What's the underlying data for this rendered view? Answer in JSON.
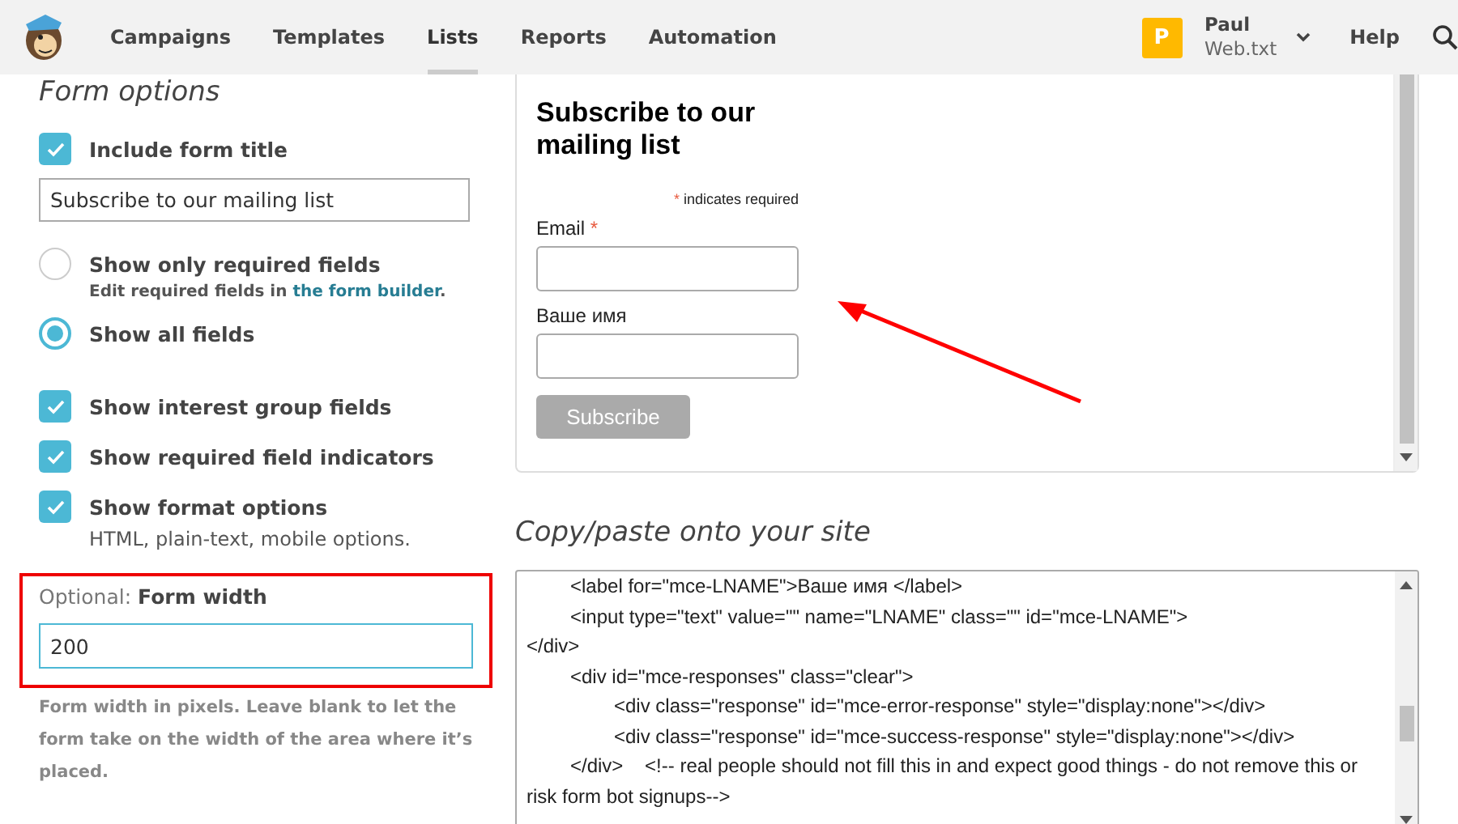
{
  "nav": {
    "items": [
      {
        "label": "Campaigns",
        "selected": false
      },
      {
        "label": "Templates",
        "selected": false
      },
      {
        "label": "Lists",
        "selected": true
      },
      {
        "label": "Reports",
        "selected": false
      },
      {
        "label": "Automation",
        "selected": false
      }
    ],
    "user": {
      "initial": "P",
      "name": "Paul",
      "account": "Web.txt"
    },
    "help": "Help"
  },
  "form_options": {
    "title": "Form options",
    "options": [
      {
        "kind": "checkbox",
        "label": "Include form title",
        "checked": true,
        "value": "Subscribe to our mailing list"
      },
      {
        "kind": "radio",
        "label": "Show only required fields",
        "selected": false,
        "hint": "Edit required fields in ",
        "link": "the form builder",
        "hint_end": "."
      },
      {
        "kind": "radio",
        "label": "Show all fields",
        "selected": true
      },
      {
        "kind": "checkbox",
        "label": "Show interest group fields",
        "checked": true
      },
      {
        "kind": "checkbox",
        "label": "Show required field indicators",
        "checked": true
      },
      {
        "kind": "checkbox",
        "label": "Show format options",
        "checked": true,
        "note": "HTML, plain-text, mobile options."
      }
    ],
    "width_field": {
      "prefix": "Optional:",
      "label": "Form width",
      "value": "200",
      "help": "Form width in pixels. Leave blank to let the form take on the width of the area where it’s placed."
    }
  },
  "preview": {
    "title": "Subscribe to our mailing list",
    "required_note": {
      "mark": "*",
      "text": "indicates required"
    },
    "fields": [
      {
        "label": "Email",
        "mark": "*"
      },
      {
        "label": "Ваше имя"
      }
    ],
    "button": "Subscribe"
  },
  "embed": {
    "title": "Copy/paste onto your site",
    "lines": [
      "\t<label for=\"mce-LNAME\">Ваше имя </label>",
      "\t<input type=\"text\" value=\"\" name=\"LNAME\" class=\"\" id=\"mce-LNAME\">",
      "</div>",
      "\t<div id=\"mce-responses\" class=\"clear\">",
      "\t\t<div class=\"response\" id=\"mce-error-response\" style=\"display:none\"></div>",
      "\t\t<div class=\"response\" id=\"mce-success-response\" style=\"display:none\"></div>",
      "\t</div>    <!-- real people should not fill this in and expect good things - do not remove this or risk form bot signups-->"
    ]
  }
}
